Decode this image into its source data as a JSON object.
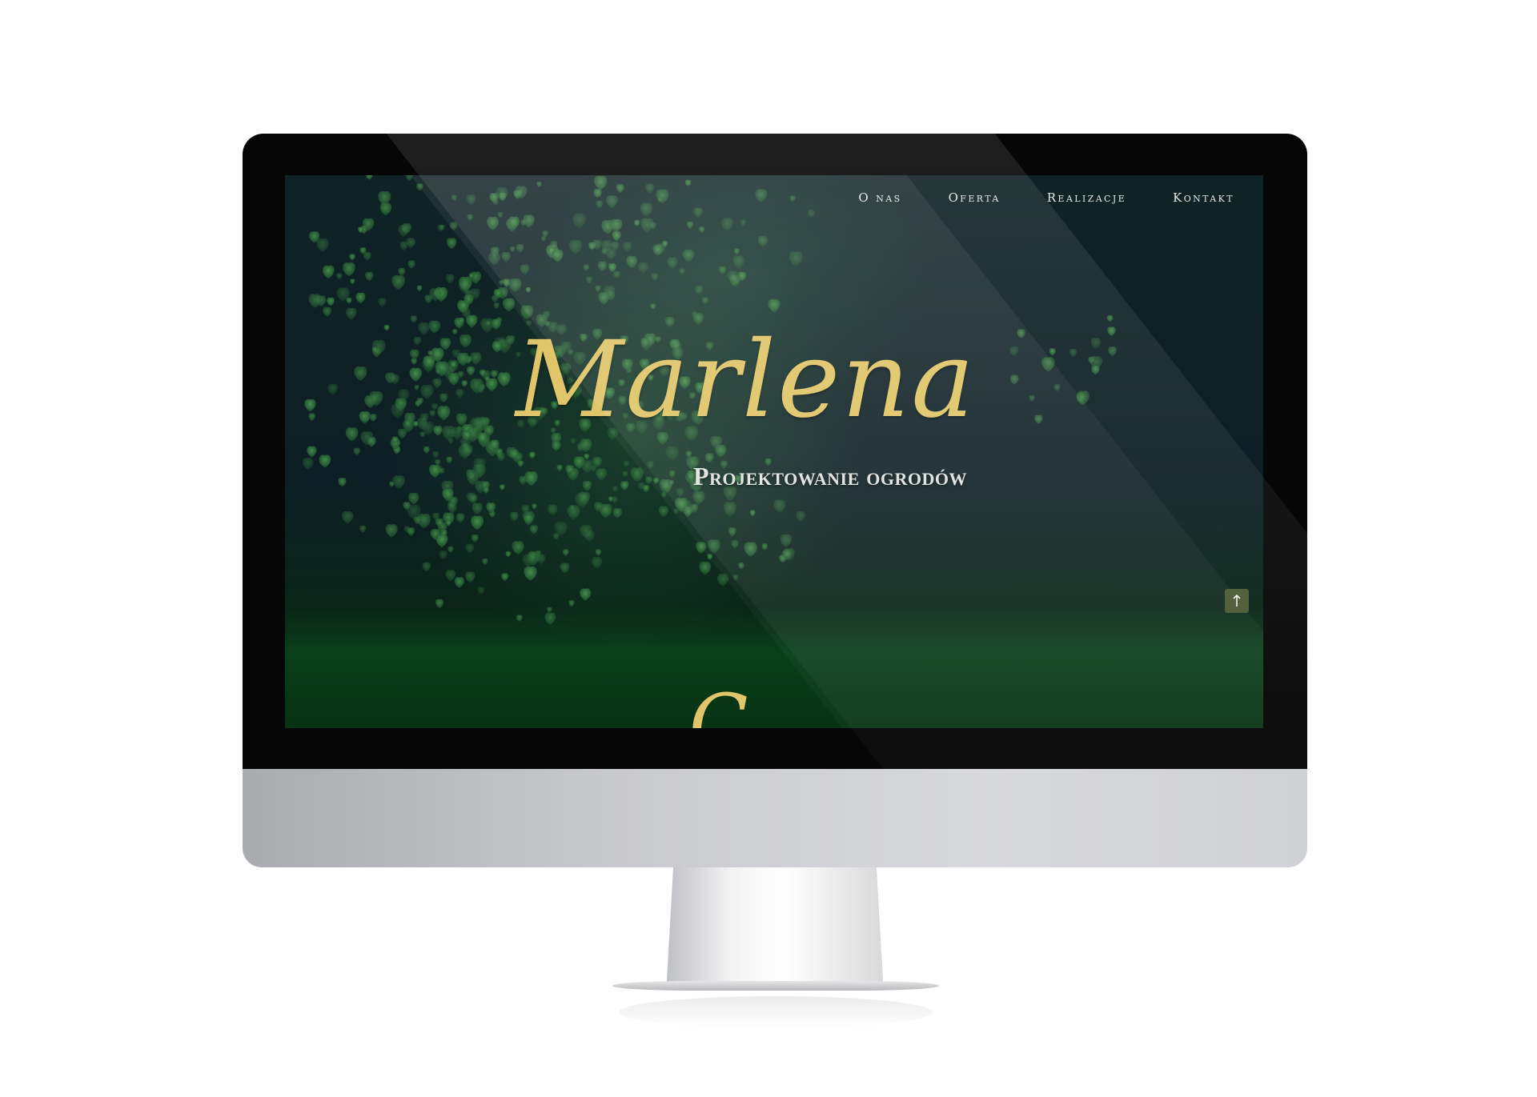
{
  "nav": {
    "items": [
      {
        "label": "O nas"
      },
      {
        "label": "Oferta"
      },
      {
        "label": "Realizacje"
      },
      {
        "label": "Kontakt"
      }
    ]
  },
  "hero": {
    "title": "Marlena",
    "subtitle": "Projektowanie ogrodów"
  },
  "next_section": {
    "heading_fragment": "C"
  },
  "scroll_top": {
    "icon": "arrow-up-icon"
  },
  "colors": {
    "accent_gold": "#e0c56a",
    "nav_text": "#e7ebe6",
    "background_dark": "#0f2225",
    "background_green": "#0a3e1a"
  }
}
